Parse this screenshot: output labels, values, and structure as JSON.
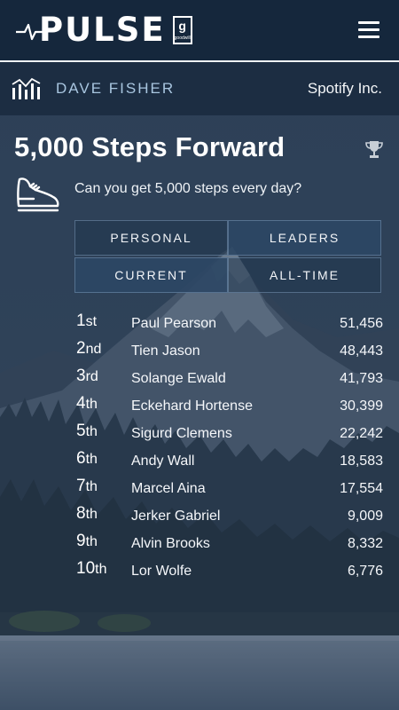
{
  "header": {
    "logo_text": "PULSE",
    "logo_badge_letter": "g",
    "logo_badge_word": "goodwill",
    "menu_icon": "hamburger-icon"
  },
  "subheader": {
    "icon": "bar-chart-icon",
    "user_name": "DAVE FISHER",
    "company": "Spotify Inc."
  },
  "challenge": {
    "title": "5,000 Steps Forward",
    "trophy_icon": "trophy-icon",
    "shoe_icon": "shoe-icon",
    "description": "Can you get 5,000 steps every day?"
  },
  "tabs": {
    "personal": "PERSONAL",
    "leaders": "LEADERS",
    "current": "CURRENT",
    "all_time": "ALL-TIME",
    "active_scope": "leaders",
    "active_period": "current"
  },
  "leaderboard": [
    {
      "num": "1",
      "suffix": "st",
      "name": "Paul Pearson",
      "steps": "51,456"
    },
    {
      "num": "2",
      "suffix": "nd",
      "name": "Tien Jason",
      "steps": "48,443"
    },
    {
      "num": "3",
      "suffix": "rd",
      "name": "Solange Ewald",
      "steps": "41,793"
    },
    {
      "num": "4",
      "suffix": "th",
      "name": "Eckehard Hortense",
      "steps": "30,399"
    },
    {
      "num": "5",
      "suffix": "th",
      "name": "Sigurd Clemens",
      "steps": "22,242"
    },
    {
      "num": "6",
      "suffix": "th",
      "name": "Andy Wall",
      "steps": "18,583"
    },
    {
      "num": "7",
      "suffix": "th",
      "name": "Marcel Aina",
      "steps": "17,554"
    },
    {
      "num": "8",
      "suffix": "th",
      "name": "Jerker Gabriel",
      "steps": "9,009"
    },
    {
      "num": "9",
      "suffix": "th",
      "name": "Alvin Brooks",
      "steps": "8,332"
    },
    {
      "num": "10",
      "suffix": "th",
      "name": "Lor Wolfe",
      "steps": "6,776"
    }
  ],
  "colors": {
    "header_bg": "#15273c",
    "subheader_bg": "#1c2d42",
    "accent_name": "#a9c6e0"
  }
}
